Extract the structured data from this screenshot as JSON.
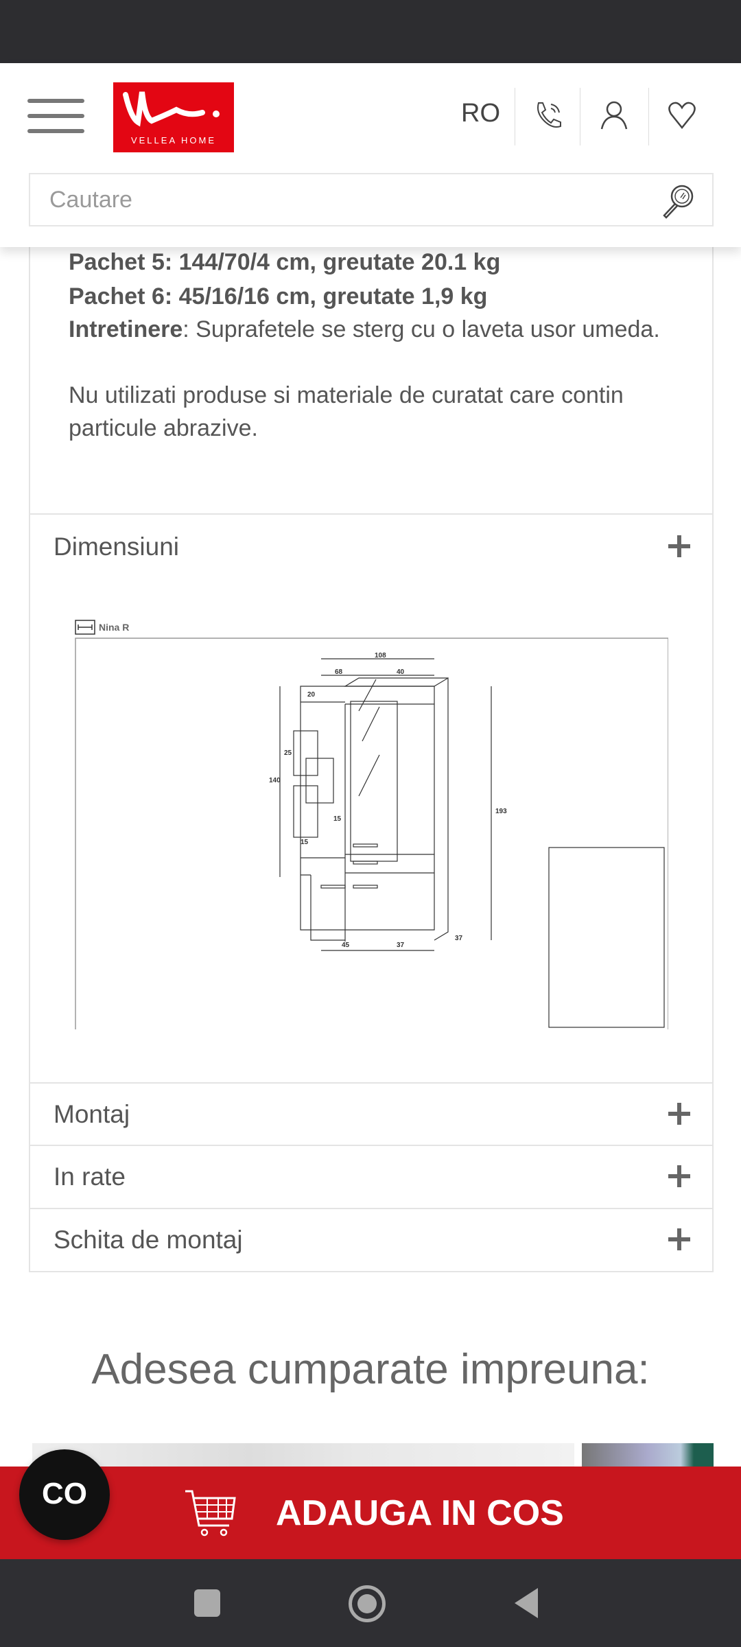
{
  "header": {
    "logo_text": "VELLEA HOME",
    "language": "RO",
    "search_placeholder": "Cautare"
  },
  "description": {
    "lines": [
      "Pachet 5: 144/70/4 cm, greutate 20.1 kg",
      "Pachet 6: 45/16/16 cm, greutate 1,9 kg"
    ],
    "care_label": "Intretinere",
    "care_text": ": Suprafetele se sterg cu o laveta usor umeda.",
    "warning": "Nu utilizati produse si materiale de curatat care contin particule abrazive."
  },
  "accordion": [
    {
      "label": "Dimensiuni"
    },
    {
      "label": "Montaj"
    },
    {
      "label": "In rate"
    },
    {
      "label": "Schita de montaj"
    }
  ],
  "drawing": {
    "title": "Nina R",
    "dims": {
      "total_width": "108",
      "left_width": "68",
      "right_width": "40",
      "shelf": "20",
      "box_height": "25",
      "panel_height": "140",
      "total_height": "193",
      "depth_box": "15",
      "box_width": "15",
      "bottom_left": "45",
      "bottom_right": "37",
      "depth": "37"
    }
  },
  "related": {
    "heading": "Adesea cumparate impreuna:"
  },
  "cart": {
    "label": "ADAUGA IN COS",
    "color": "#c8161e"
  },
  "chat": {
    "label": "CO"
  }
}
